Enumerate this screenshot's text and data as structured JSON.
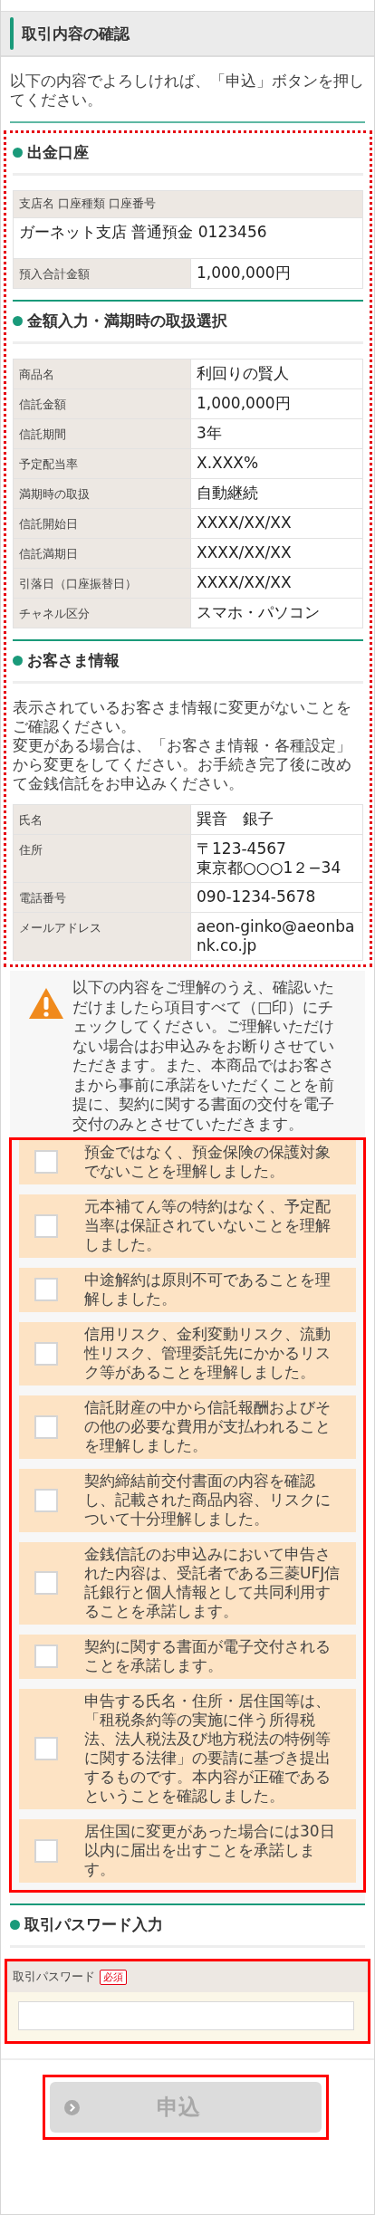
{
  "page_title": "取引内容の確認",
  "intro": "以下の内容でよろしければ、「申込」ボタンを押してください。",
  "details": {
    "highlighted": true,
    "sections": [
      {
        "heading": "出金口座",
        "account": {
          "label": "支店名 口座種類 口座番号",
          "value": "ガーネット支店 普通預金 0123456"
        },
        "rows": [
          {
            "label": "預入合計金額",
            "lines": [
              "1,000,000円"
            ]
          }
        ]
      },
      {
        "heading": "金額入力・満期時の取扱選択",
        "rows": [
          {
            "label": "商品名",
            "lines": [
              "利回りの賢人"
            ]
          },
          {
            "label": "信託金額",
            "lines": [
              "1,000,000円"
            ]
          },
          {
            "label": "信託期間",
            "lines": [
              "3年"
            ]
          },
          {
            "label": "予定配当率",
            "lines": [
              "X.XXX%"
            ]
          },
          {
            "label": "満期時の取扱",
            "lines": [
              "自動継続"
            ]
          },
          {
            "label": "信託開始日",
            "lines": [
              "XXXX/XX/XX"
            ]
          },
          {
            "label": "信託満期日",
            "lines": [
              "XXXX/XX/XX"
            ]
          },
          {
            "label": "引落日（口座振替日）",
            "lines": [
              "XXXX/XX/XX"
            ]
          },
          {
            "label": "チャネル区分",
            "lines": [
              "スマホ・パソコン"
            ]
          }
        ]
      },
      {
        "heading": "お客さま情報",
        "notes": [
          "表示されているお客さま情報に変更がないことをご確認ください。",
          "変更がある場合は、「お客さま情報・各種設定」から変更をしてください。お手続き完了後に改めて金銭信託をお申込みください。"
        ],
        "rows": [
          {
            "label": "氏名",
            "lines": [
              "巽音　銀子"
            ]
          },
          {
            "label": "住所",
            "lines": [
              "〒123-4567",
              "東京都○○○1２−34"
            ]
          },
          {
            "label": "電話番号",
            "lines": [
              "090-1234-5678"
            ]
          },
          {
            "label": "メールアドレス",
            "lines": [
              "aeon-ginko@aeonbank.co.jp"
            ]
          }
        ]
      }
    ]
  },
  "warning": "以下の内容をご理解のうえ、確認いただけましたら項目すべて（□印）にチェックしてください。ご理解いただけない場合はお申込みをお断りさせていただきます。また、本商品ではお客さまから事前に承諾をいただくことを前提に、契約に関する書面の交付を電子交付のみとさせていただきます。",
  "agreements": {
    "highlighted": true,
    "items": [
      {
        "text": "預金ではなく、預金保険の保護対象でないことを理解しました。",
        "checked": false
      },
      {
        "text": "元本補てん等の特約はなく、予定配当率は保証されていないことを理解しました。",
        "checked": false
      },
      {
        "text": "中途解約は原則不可であることを理解しました。",
        "checked": false
      },
      {
        "text": "信用リスク、金利変動リスク、流動性リスク、管理委託先にかかるリスク等があることを理解しました。",
        "checked": false
      },
      {
        "text": "信託財産の中から信託報酬およびその他の必要な費用が支払われることを理解しました。",
        "checked": false
      },
      {
        "text": "契約締結前交付書面の内容を確認し、記載された商品内容、リスクについて十分理解しました。",
        "checked": false
      },
      {
        "text": "金銭信託のお申込みにおいて申告された内容は、受託者である三菱UFJ信託銀行と個人情報として共同利用することを承諾します。",
        "checked": false
      },
      {
        "text": "契約に関する書面が電子交付されることを承諾します。",
        "checked": false
      },
      {
        "text": "申告する氏名・住所・居住国等は、「租税条約等の実施に伴う所得税法、法人税法及び地方税法の特例等に関する法律」の要請に基づき提出するものです。本内容が正確であるということを確認しました。",
        "checked": false
      },
      {
        "text": "居住国に変更があった場合には30日以内に届出を出すことを承諾します。",
        "checked": false
      }
    ]
  },
  "password": {
    "heading": "取引パスワード入力",
    "label": "取引パスワード",
    "badge": "必須",
    "highlighted": true
  },
  "submit": {
    "label": "申込",
    "disabled": true,
    "highlighted": true
  }
}
